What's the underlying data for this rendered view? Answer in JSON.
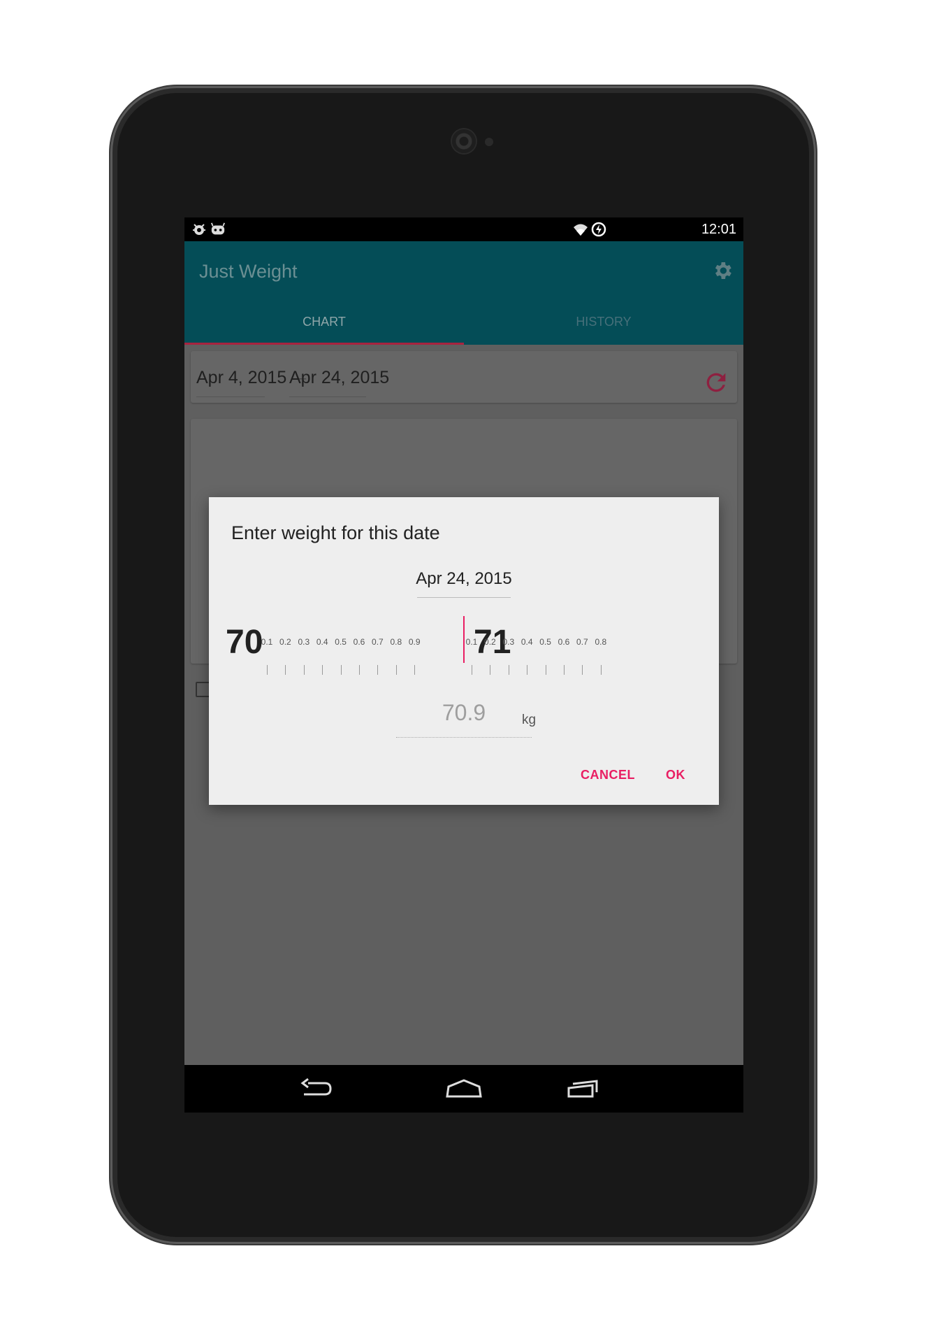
{
  "status_bar": {
    "time": "12:01",
    "left_icons": [
      "bug-icon",
      "cyanogenmod-icon"
    ],
    "right_icons": [
      "wifi-icon",
      "battery-charging-icon"
    ]
  },
  "app_bar": {
    "title": "Just Weight",
    "settings_icon": "gear-icon",
    "tabs": [
      {
        "label": "CHART",
        "selected": true
      },
      {
        "label": "HISTORY",
        "selected": false
      }
    ]
  },
  "date_range": {
    "start": "Apr 4, 2015",
    "separator": "–",
    "end": "Apr 24, 2015",
    "refresh_icon": "refresh-icon"
  },
  "dialog": {
    "title": "Enter weight for this date",
    "date": "Apr 24, 2015",
    "ruler": {
      "major_left": "70",
      "major_right": "71",
      "minor_left": [
        "0.1",
        "0.2",
        "0.3",
        "0.4",
        "0.5",
        "0.6",
        "0.7",
        "0.8",
        "0.9"
      ],
      "minor_right": [
        "0.1",
        "0.2",
        "0.3",
        "0.4",
        "0.5",
        "0.6",
        "0.7",
        "0.8"
      ]
    },
    "value": "70.9",
    "unit": "kg",
    "cancel_label": "CANCEL",
    "ok_label": "OK"
  },
  "nav_bar": {
    "icons": [
      "back-icon",
      "home-icon",
      "recents-icon"
    ]
  },
  "colors": {
    "app_bar": "#044d57",
    "accent": "#e91e63",
    "tab_indicator": "#a8233f"
  }
}
